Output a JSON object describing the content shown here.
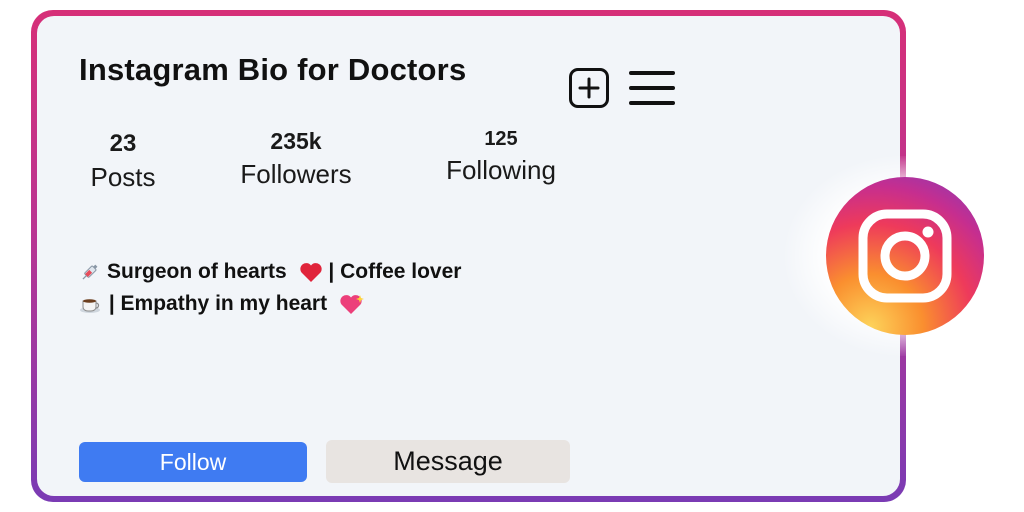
{
  "profile": {
    "title": "Instagram Bio for Doctors",
    "stats": [
      {
        "value": "23",
        "label": "Posts"
      },
      {
        "value": "235k",
        "label": "Followers"
      },
      {
        "value": "125",
        "label": "Following"
      }
    ],
    "bio": [
      {
        "emoji": "syringe-icon",
        "text": "Surgeon of hearts",
        "emoji2": "red-heart-icon",
        "text2": " | Coffee lover"
      },
      {
        "emoji": "coffee-cup-icon",
        "text": " | Empathy in my heart",
        "emoji2": "sparkling-heart-icon"
      }
    ]
  },
  "toolbar": {
    "add_icon": "plus-square-icon",
    "menu_icon": "hamburger-menu-icon"
  },
  "actions": {
    "follow_label": "Follow",
    "message_label": "Message"
  },
  "brand": {
    "logo": "instagram-logo",
    "frame_colors": [
      "#d62f78",
      "#7a3bb4"
    ],
    "follow_color": "#3f7bf2"
  }
}
